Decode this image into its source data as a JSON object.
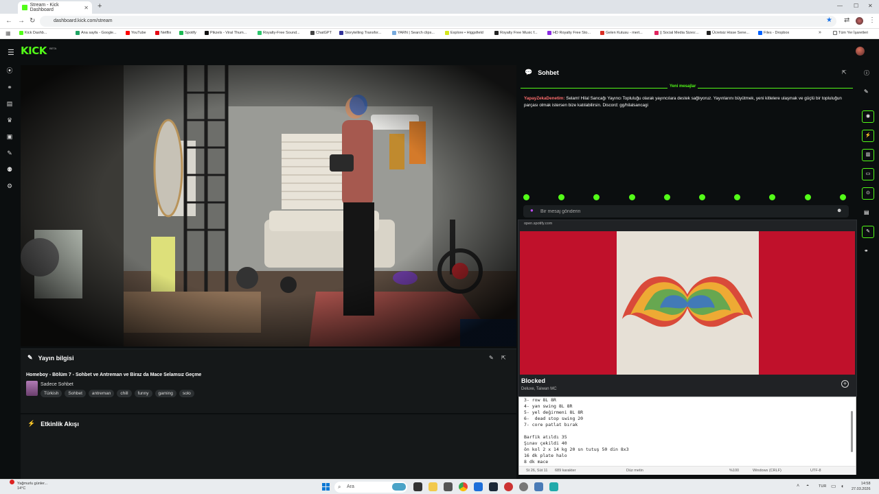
{
  "browser": {
    "tab_title": "Stream - Kick Dashboard",
    "url": "dashboard.kick.com/stream",
    "bookmarks": [
      {
        "label": "Kick Dashb...",
        "icon": "kick-icon",
        "color": "#53fc18"
      },
      {
        "label": "Ana sayfa - Google...",
        "icon": "google-drive-icon",
        "color": "#1fa463"
      },
      {
        "label": "YouTube",
        "icon": "youtube-icon",
        "color": "#ff0000"
      },
      {
        "label": "Netflix",
        "icon": "netflix-icon",
        "color": "#e50914"
      },
      {
        "label": "Spotify",
        "icon": "spotify-icon",
        "color": "#1db954"
      },
      {
        "label": "Pikzels - Viral Thum...",
        "icon": "pikzels-icon",
        "color": "#111111"
      },
      {
        "label": "Royalty-Free Sound...",
        "icon": "pixabay-icon",
        "color": "#2ec66d"
      },
      {
        "label": "ChatGPT",
        "icon": "chatgpt-icon",
        "color": "#444444"
      },
      {
        "label": "Storytelling Transfor...",
        "icon": "video-icon",
        "color": "#333399"
      },
      {
        "label": "YARN | Search clips...",
        "icon": "yarn-icon",
        "color": "#7ad"
      },
      {
        "label": "Explore • Higgsfield",
        "icon": "higgsfield-icon",
        "color": "#d4e61c"
      },
      {
        "label": "Royalty Free Music f...",
        "icon": "music-icon",
        "color": "#222222"
      },
      {
        "label": "HD Royalty Free Sto...",
        "icon": "stock-icon",
        "color": "#8a2be2"
      },
      {
        "label": "Gelen Kutusu - mert...",
        "icon": "gmail-icon",
        "color": "#d93025"
      },
      {
        "label": "|| Social Media Sizes:...",
        "icon": "social-icon",
        "color": "#e0245e"
      },
      {
        "label": "Ücretsiz Hisse Sene...",
        "icon": "stock-chart-icon",
        "color": "#222222"
      },
      {
        "label": "Files - Dropbox",
        "icon": "dropbox-icon",
        "color": "#0061ff"
      }
    ],
    "all_bookmarks_label": "Tüm Yer İşaretleri"
  },
  "kick": {
    "logo": "KICK",
    "beta": "BETA"
  },
  "info_panel": {
    "heading": "Yayın bilgisi",
    "stream_title": "Homeboy - Bölüm 7 - Sohbet ve Antreman ve Biraz da Mace Selamsız Geçme",
    "category": "Sadece Sohbet",
    "tags": [
      "Türkish",
      "Sohbet",
      "antreman",
      "chill",
      "funny",
      "gaming",
      "solo"
    ]
  },
  "activity_panel": {
    "heading": "Etkinlik Akışı"
  },
  "chat": {
    "heading": "Sohbet",
    "new_messages_label": "Yeni mesajlar",
    "message_user": "YapayZekaDenetim:",
    "message_text": " Selam! Hilal Sancağı Yayıncı Topluluğu olarak yayıncılara destek sağlıyoruz. Yayınlarını büyütmek, yeni kitlelere ulaşmak ve güçlü bir topluluğun parçası olmak istersen bize katılabilirsin. Discord: gg/hilalsancagi",
    "input_placeholder": "Bir mesaj gönderin"
  },
  "spotify_pip": {
    "url": "open.spotify.com",
    "track_name": "Blocked",
    "artist": "Deluxe, Taiwan MC",
    "accent": "#c0112b"
  },
  "notepad": {
    "lines": [
      "3- row 8L 8R",
      "4- yan swing 8L 8R",
      "5- yel değirmeni 8L 8R",
      "6-  dead stop swing 20",
      "7- core patlat bırak",
      "",
      "Barfik atıldı 35",
      "Şınav çekildi 40",
      "ön kol 2 x 14 kg 20 sn tutuş 50 din 8x3",
      "16 dk plate halo",
      "8 dk mace"
    ],
    "status": {
      "position": "St 26, Süt 11",
      "chars": "689 karakter",
      "format": "Düz metin",
      "zoom": "%100",
      "eol": "Windows (CRLF)",
      "encoding": "UTF-8"
    }
  },
  "taskbar": {
    "weather_title": "Yağmurlu günler...",
    "weather_temp": "14°C",
    "search_placeholder": "Ara",
    "language": "TUR",
    "time": "14:58",
    "date": "27.03.2026"
  }
}
